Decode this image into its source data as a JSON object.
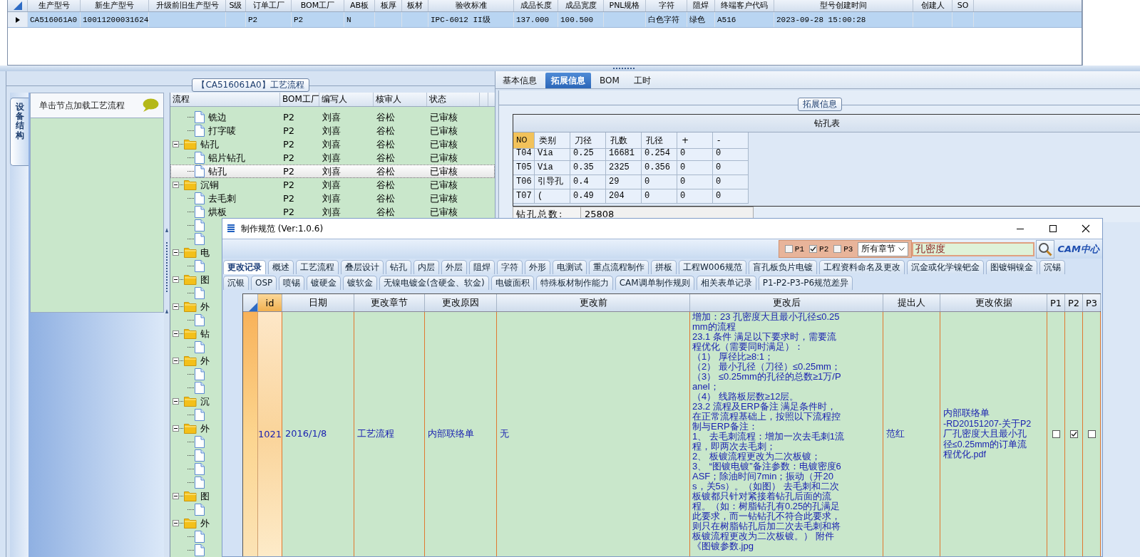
{
  "main_grid": {
    "columns": [
      "生产型号",
      "新生产型号",
      "升级前旧生产型号",
      "S级",
      "订单工厂",
      "BOM工厂",
      "AB板",
      "板厚",
      "板材",
      "验收标准",
      "成品长度",
      "成品宽度",
      "PNL规格",
      "字符",
      "阻焊",
      "终端客户代码",
      "型号创建时间",
      "创建人",
      "SO"
    ],
    "rows": [
      {
        "selected": true,
        "cells": [
          "CA516061A0",
          "10011200031624",
          null,
          null,
          "P2",
          "P2",
          "N",
          null,
          null,
          "IPC-6012 II级",
          "137.000",
          "100.500",
          null,
          "白色字符",
          "绿色",
          "A516",
          "2023-09-28 15:00:28",
          null,
          null
        ]
      }
    ]
  },
  "process_panel": {
    "title": "【CA516061A0】工艺流程",
    "side_tab": {
      "label": "设备结构",
      "selected": true
    },
    "hint": "单击节点加载工艺流程",
    "columns": [
      "流程",
      "BOM工厂",
      "编写人",
      "核审人",
      "状态"
    ],
    "tree": [
      {
        "kind": "folder",
        "children": [
          {
            "kind": "doc",
            "label": "铣边",
            "bom": "P2",
            "writer": "刘喜",
            "reviewer": "谷松",
            "status": "已审核",
            "selected": false
          },
          {
            "kind": "doc",
            "label": "打字唛",
            "bom": "P2",
            "writer": "刘喜",
            "reviewer": "谷松",
            "status": "已审核",
            "selected": false
          }
        ]
      },
      {
        "kind": "folder",
        "label": "钻孔",
        "bom": "P2",
        "writer": "刘喜",
        "reviewer": "谷松",
        "status": "已审核",
        "expanded": true,
        "selected": false,
        "children": [
          {
            "kind": "doc",
            "label": "铝片钻孔",
            "bom": "P2",
            "writer": "刘喜",
            "reviewer": "谷松",
            "status": "已审核",
            "selected": false
          },
          {
            "kind": "doc",
            "label": "钻孔",
            "bom": "P2",
            "writer": "刘喜",
            "reviewer": "谷松",
            "status": "已审核",
            "selected": true
          }
        ]
      },
      {
        "kind": "folder",
        "label": "沉铜",
        "bom": "P2",
        "writer": "刘喜",
        "reviewer": "谷松",
        "status": "已审核",
        "expanded": true,
        "selected": false,
        "children": [
          {
            "kind": "doc",
            "label": "去毛刺",
            "bom": "P2",
            "writer": "刘喜",
            "reviewer": "谷松",
            "status": "已审核",
            "selected": false
          },
          {
            "kind": "doc",
            "label": "烘板",
            "bom": "P2",
            "writer": "刘喜",
            "reviewer": "谷松",
            "status": "已审核",
            "selected": false
          },
          {
            "kind": "doc",
            "selected": false
          },
          {
            "kind": "doc",
            "selected": false
          }
        ]
      },
      {
        "kind": "folder",
        "label": "电",
        "expanded": true,
        "selected": false,
        "children": [
          {
            "kind": "doc",
            "selected": false
          }
        ]
      },
      {
        "kind": "folder",
        "label": "图",
        "expanded": true,
        "selected": false,
        "children": [
          {
            "kind": "doc",
            "selected": false
          }
        ]
      },
      {
        "kind": "folder",
        "label": "外",
        "expanded": true,
        "selected": false,
        "children": [
          {
            "kind": "doc",
            "selected": false
          }
        ]
      },
      {
        "kind": "folder",
        "label": "钻",
        "expanded": true,
        "selected": false,
        "children": [
          {
            "kind": "doc",
            "selected": false
          }
        ]
      },
      {
        "kind": "folder",
        "label": "外",
        "expanded": true,
        "selected": false,
        "children": [
          {
            "kind": "doc",
            "selected": false
          },
          {
            "kind": "doc",
            "selected": false
          }
        ]
      },
      {
        "kind": "folder",
        "label": "沉",
        "expanded": true,
        "selected": false,
        "children": [
          {
            "kind": "doc",
            "selected": false
          }
        ]
      },
      {
        "kind": "folder",
        "label": "外",
        "expanded": true,
        "selected": false,
        "children": [
          {
            "kind": "doc",
            "selected": false
          },
          {
            "kind": "doc",
            "selected": false
          },
          {
            "kind": "doc",
            "selected": false
          },
          {
            "kind": "doc",
            "selected": false
          }
        ]
      },
      {
        "kind": "folder",
        "label": "图",
        "expanded": true,
        "selected": false,
        "children": [
          {
            "kind": "doc",
            "selected": false
          }
        ]
      },
      {
        "kind": "folder",
        "label": "外",
        "expanded": true,
        "selected": false,
        "children": [
          {
            "kind": "doc",
            "selected": false
          },
          {
            "kind": "doc",
            "selected": false
          }
        ]
      }
    ]
  },
  "detail_panel": {
    "tabs": [
      {
        "label": "基本信息",
        "selected": false
      },
      {
        "label": "拓展信息",
        "selected": true
      },
      {
        "label": "BOM",
        "selected": false
      },
      {
        "label": "工时",
        "selected": false
      }
    ],
    "group_title": "拓展信息",
    "drill_table": {
      "title": "钻孔表",
      "columns": [
        "NO",
        "类别",
        "刀径",
        "孔数",
        "孔径",
        "+",
        "-"
      ],
      "rows": [
        [
          "T04",
          "Via",
          "0.25",
          "16681",
          "0.254",
          "0",
          "0"
        ],
        [
          "T05",
          "Via",
          "0.35",
          "2325",
          "0.356",
          "0",
          "0"
        ],
        [
          "T06",
          "引导孔",
          "0.4",
          "29",
          "0",
          "0",
          "0"
        ],
        [
          "T07",
          "(",
          "0.49",
          "204",
          "0",
          "0",
          "0"
        ]
      ]
    },
    "total_label": "钻孔总数:",
    "total_value": "25808"
  },
  "dialog": {
    "title": "制作规范 (Ver:1.0.6)",
    "plant_filters": [
      {
        "label": "P1",
        "checked": false
      },
      {
        "label": "P2",
        "checked": true
      },
      {
        "label": "P3",
        "checked": false
      }
    ],
    "chapter_select": "所有章节",
    "search": {
      "value": "孔密度"
    },
    "logo": "CAM中心",
    "tab_rows": [
      [
        {
          "label": "更改记录",
          "selected": true
        },
        {
          "label": "概述",
          "selected": false
        },
        {
          "label": "工艺流程",
          "selected": false
        },
        {
          "label": "叠层设计",
          "selected": false
        },
        {
          "label": "钻孔",
          "selected": false
        },
        {
          "label": "内层",
          "selected": false
        },
        {
          "label": "外层",
          "selected": false
        },
        {
          "label": "阻焊",
          "selected": false
        },
        {
          "label": "字符",
          "selected": false
        },
        {
          "label": "外形",
          "selected": false
        },
        {
          "label": "电测试",
          "selected": false
        },
        {
          "label": "重点流程制作",
          "selected": false
        },
        {
          "label": "拼板",
          "selected": false
        },
        {
          "label": "工程W006规范",
          "selected": false
        },
        {
          "label": "盲孔板负片电镀",
          "selected": false
        },
        {
          "label": "工程资料命名及更改",
          "selected": false
        },
        {
          "label": "沉金或化学镍钯金",
          "selected": false
        },
        {
          "label": "图镀铜镍金",
          "selected": false
        },
        {
          "label": "沉锡",
          "selected": false
        }
      ],
      [
        {
          "label": "沉银",
          "selected": false
        },
        {
          "label": "OSP",
          "selected": false
        },
        {
          "label": "喷锡",
          "selected": false
        },
        {
          "label": "镀硬金",
          "selected": false
        },
        {
          "label": "镀软金",
          "selected": false
        },
        {
          "label": "无镍电镀金(含硬金、软金)",
          "selected": false
        },
        {
          "label": "电镀面积",
          "selected": false
        },
        {
          "label": "特殊板材制作能力",
          "selected": false
        },
        {
          "label": "CAM调单制作规则",
          "selected": false
        },
        {
          "label": "相关表单记录",
          "selected": false
        },
        {
          "label": "P1-P2-P3-P6规范差异",
          "selected": false
        }
      ]
    ],
    "grid": {
      "columns": [
        "id",
        "日期",
        "更改章节",
        "更改原因",
        "更改前",
        "更改后",
        "提出人",
        "更改依据",
        "P1",
        "P2",
        "P3"
      ],
      "rows": [
        {
          "selected": true,
          "id": "1021",
          "date": "2016/1/8",
          "chapter": "工艺流程",
          "reason": "内部联络单",
          "before": "无",
          "after": [
            "增加：23 孔密度大且最小孔径≤0.25mm的流程",
            "23.1 条件 满足以下要求时，需要流程优化（需要同时满足）：",
            "（1） 厚径比≥8:1；",
            "（2） 最小孔径（刀径）≤0.25mm；",
            "（3） ≤0.25mm的孔径的总数≥1万/Panel；",
            "（4） 线路板层数≥12层。",
            "23.2 流程及ERP备注 满足条件时，在正常流程基础上，按照以下流程控制与ERP备注：",
            "1、 去毛刺流程：增加一次去毛刺1流程，即两次去毛刺；",
            "2、 板镀流程更改为二次板镀；",
            "3、 “图镀电镀”备注参数：电镀密度6ASF；除油时间7min；振动（开20s，关5s）。（如图） 去毛刺和二次板镀都只针对紧接着钻孔后面的流程。（如：树脂钻孔有0.25的孔满足此要求，而一钻钻孔不符合此要求，则只在树脂钻孔后加二次去毛刺和将板镀流程更改为二次板镀。） 附件《图镀参数.jpg"
          ],
          "proposer": "范红",
          "basis": "内部联络单\n-RD20151207-关于P2厂孔密度大且最小孔径≤0.25mm的订单流程优化.pdf",
          "p1": false,
          "p2": true,
          "p3": false
        }
      ]
    }
  }
}
